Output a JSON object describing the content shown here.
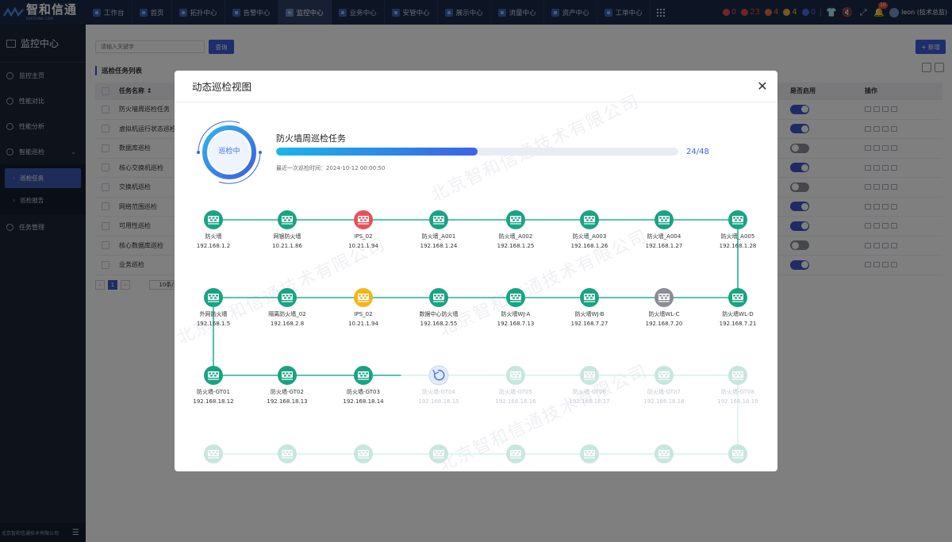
{
  "topbar": {
    "logo": {
      "text": "智和信通",
      "subtext": "SYSTHINK.COM"
    },
    "tabs": [
      {
        "label": "工作台",
        "active": false
      },
      {
        "label": "首页",
        "active": false
      },
      {
        "label": "拓扑中心",
        "active": false
      },
      {
        "label": "告警中心",
        "active": false
      },
      {
        "label": "监控中心",
        "active": true
      },
      {
        "label": "业务中心",
        "active": false
      },
      {
        "label": "安管中心",
        "active": false
      },
      {
        "label": "展示中心",
        "active": false
      },
      {
        "label": "流量中心",
        "active": false
      },
      {
        "label": "资产中心",
        "active": false
      },
      {
        "label": "工单中心",
        "active": false
      }
    ],
    "alarms": [
      {
        "count": "0",
        "color": "#e84a5f"
      },
      {
        "count": "23",
        "color": "#e8463f"
      },
      {
        "count": "4",
        "color": "#f06a3a"
      },
      {
        "count": "4",
        "color": "#f2b134"
      },
      {
        "count": "0",
        "color": "#4a6ee0"
      }
    ],
    "notification_count": "10",
    "user": "leon (技术总监)"
  },
  "sidebar": {
    "title": "监控中心",
    "items": [
      {
        "label": "监控主页"
      },
      {
        "label": "性能对比"
      },
      {
        "label": "性能分析"
      },
      {
        "label": "智能巡检",
        "expanded": true
      }
    ],
    "subitems": [
      {
        "label": "巡检任务",
        "active": true
      },
      {
        "label": "巡检报告",
        "active": false
      }
    ],
    "after": [
      {
        "label": "任务管理"
      }
    ],
    "footer": "北京智和信通技术有限公司"
  },
  "main": {
    "search_placeholder": "请输入关键字",
    "query_label": "查询",
    "add_label": "+ 新增",
    "list_title": "巡检任务列表",
    "columns": {
      "name": "任务名称 ↕",
      "enabled": "是否启用",
      "ops": "操作"
    },
    "rows": [
      {
        "name": "防火墙周巡检任务",
        "enabled": true
      },
      {
        "name": "虚拟机运行状态巡检",
        "enabled": true
      },
      {
        "name": "数据库巡检",
        "enabled": false
      },
      {
        "name": "核心交换机巡检",
        "enabled": true
      },
      {
        "name": "交换机巡检",
        "enabled": false
      },
      {
        "name": "网络范围巡检",
        "enabled": true
      },
      {
        "name": "可用性巡检",
        "enabled": true
      },
      {
        "name": "核心数据库巡检",
        "enabled": false
      },
      {
        "name": "业务巡检",
        "enabled": true
      }
    ],
    "pager": {
      "page": "1",
      "size": "10条/页"
    }
  },
  "modal": {
    "title": "动态巡检视图",
    "status": "巡检中",
    "task_name": "防火墙周巡检任务",
    "progress": {
      "done": 24,
      "total": 48,
      "text": "24/48"
    },
    "last_time_label": "最近一次巡检时间：",
    "last_time_value": "2024-10-12 00:00:50",
    "watermark": "北京智和信通技术有限公司",
    "colors": {
      "ok": "#1aa383",
      "error": "#e8505b",
      "warn": "#f2b51a",
      "offline": "#8a8d94",
      "pending": "#c7e6de",
      "line": "#20b392",
      "spinner": "#4a7de8"
    },
    "devices": [
      {
        "name": "防火墙",
        "ip": "192.168.1.2",
        "status": "ok"
      },
      {
        "name": "网银防火墙",
        "ip": "10.21.1.86",
        "status": "ok"
      },
      {
        "name": "IPS_02",
        "ip": "10.21.1.94",
        "status": "error"
      },
      {
        "name": "防火墙_A001",
        "ip": "192.168.1.24",
        "status": "ok"
      },
      {
        "name": "防火墙_A002",
        "ip": "192.168.1.25",
        "status": "ok"
      },
      {
        "name": "防火墙_A003",
        "ip": "192.168.1.26",
        "status": "ok"
      },
      {
        "name": "防火墙_A004",
        "ip": "192.168.1.27",
        "status": "ok"
      },
      {
        "name": "防火墙_A005",
        "ip": "192.168.1.28",
        "status": "ok"
      },
      {
        "name": "防火墙WL-D",
        "ip": "192.168.7.21",
        "status": "ok"
      },
      {
        "name": "防火墙WL-C",
        "ip": "192.168.7.20",
        "status": "offline"
      },
      {
        "name": "防火墙WJ-B",
        "ip": "192.168.7.27",
        "status": "ok"
      },
      {
        "name": "防火墙WJ-A",
        "ip": "192.168.7.13",
        "status": "ok"
      },
      {
        "name": "数据中心防火墙",
        "ip": "192.168.2.55",
        "status": "ok"
      },
      {
        "name": "IPS_02",
        "ip": "10.21.1.94",
        "status": "warn"
      },
      {
        "name": "隔离防火墙_02",
        "ip": "192.168.2.8",
        "status": "ok"
      },
      {
        "name": "外网防火墙",
        "ip": "192.168.1.5",
        "status": "ok"
      },
      {
        "name": "防火墙-GT01",
        "ip": "192.168.18.12",
        "status": "ok"
      },
      {
        "name": "防火墙-GT02",
        "ip": "192.168.18.13",
        "status": "ok"
      },
      {
        "name": "防火墙-GT03",
        "ip": "192.168.18.14",
        "status": "ok"
      },
      {
        "name": "防火墙-GT04",
        "ip": "192.168.18.15",
        "status": "running"
      },
      {
        "name": "防火墙-GT05",
        "ip": "192.168.18.16",
        "status": "pending"
      },
      {
        "name": "防火墙-GT06",
        "ip": "192.168.18.17",
        "status": "pending"
      },
      {
        "name": "防火墙-GT07",
        "ip": "192.168.18.18",
        "status": "pending"
      },
      {
        "name": "防火墙-GT08",
        "ip": "192.168.18.19",
        "status": "pending"
      },
      {
        "name": "",
        "ip": "",
        "status": "pending"
      },
      {
        "name": "",
        "ip": "",
        "status": "pending"
      },
      {
        "name": "",
        "ip": "",
        "status": "pending"
      },
      {
        "name": "",
        "ip": "",
        "status": "pending"
      },
      {
        "name": "",
        "ip": "",
        "status": "pending"
      },
      {
        "name": "",
        "ip": "",
        "status": "pending"
      },
      {
        "name": "",
        "ip": "",
        "status": "pending"
      },
      {
        "name": "",
        "ip": "",
        "status": "pending"
      }
    ]
  }
}
